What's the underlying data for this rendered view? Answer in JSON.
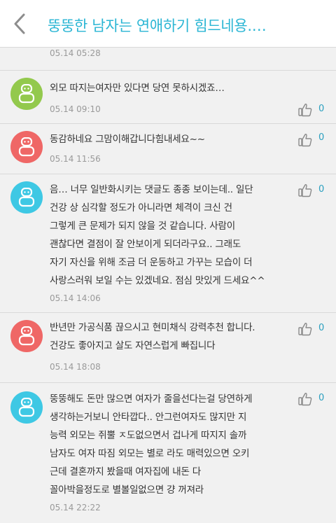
{
  "header": {
    "title": "뚱뚱한 남자는 연애하기 힘드네용.…"
  },
  "previous_comment_time": "05.14 05:28",
  "comments": [
    {
      "avatar_color": "#93c94d",
      "text": "외모 따지는여자만 있다면 당연 못하시겠죠…",
      "time": "05.14 09:10",
      "likes": "0"
    },
    {
      "avatar_color": "#ef6766",
      "text": "동감하네요 그맘이해갑니다힘내세요~~",
      "time": "05.14 11:56",
      "likes": "0"
    },
    {
      "avatar_color": "#3ec8e4",
      "text": "음… 너무 일반화시키는 댓글도 종종 보이는데.. 일단\n건강 상 심각할 정도가 아니라면 체격이 크신 건\n그렇게 큰 문제가 되지 않을 것 같습니다. 사람이\n괜찮다면 결점이 잘 안보이게 되더라구요.. 그래도\n자기 자신을 위해 조금 더 운동하고 가꾸는 모습이 더\n사랑스러워 보일 수는 있겠네요. 점심 맛있게 드세요^^",
      "time": "05.14 14:06",
      "likes": "0"
    },
    {
      "avatar_color": "#ef6766",
      "text": "반년만 가공식품 끊으시고 현미채식 강력추천 합니다.\n건강도 좋아지고 살도 자연스럽게 빠집니다",
      "time": "05.14 18:08",
      "likes": "0"
    },
    {
      "avatar_color": "#3ec8e4",
      "text": "뚱뚱해도 돈만 많으면 여자가 줄을선다는걸 당연하게\n생각하는거보니 안타깝다.. 안그런여자도 많지만 지\n능력 외모는 쥐뿔 ㅈ도없으면서  겁나게 따지지 솔까\n남자도 여자 따짐 외모는 별로 라도 매력있으면 오키\n근데 결혼까지 봤을때 여자집에 내돈 다\n꼴아박을정도로 별볼일없으면 걍 꺼져라",
      "time": "05.14 22:22",
      "likes": "0"
    }
  ]
}
